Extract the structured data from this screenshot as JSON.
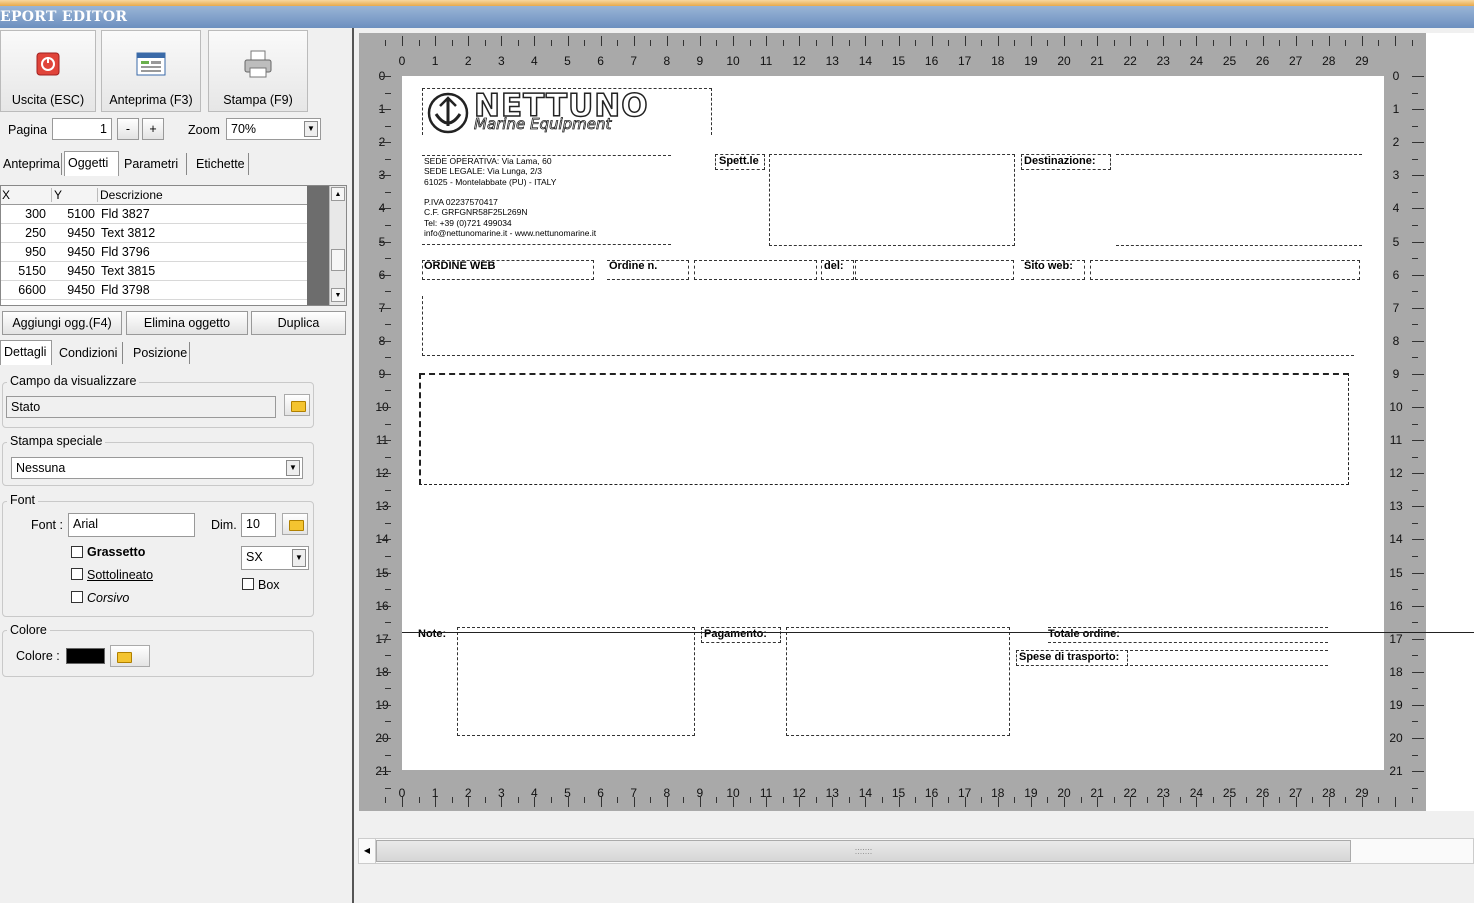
{
  "window": {
    "title": "EPORT EDITOR"
  },
  "toolbar": {
    "exit_label": "Uscita (ESC)",
    "preview_label": "Anteprima (F3)",
    "print_label": "Stampa (F9)"
  },
  "paging": {
    "page_label": "Pagina",
    "page_value": "1",
    "minus": "-",
    "plus": "+",
    "zoom_label": "Zoom",
    "zoom_value": "70%"
  },
  "tabs_top": [
    {
      "label": "Anteprima"
    },
    {
      "label": "Oggetti"
    },
    {
      "label": "Parametri"
    },
    {
      "label": "Etichette"
    }
  ],
  "objects_table": {
    "headers": {
      "x": "X",
      "y": "Y",
      "desc": "Descrizione"
    },
    "rows": [
      {
        "x": "300",
        "y": "5100",
        "desc": "Fld 3827"
      },
      {
        "x": "250",
        "y": "9450",
        "desc": "Text 3812"
      },
      {
        "x": "950",
        "y": "9450",
        "desc": "Fld 3796"
      },
      {
        "x": "5150",
        "y": "9450",
        "desc": "Text 3815"
      },
      {
        "x": "6600",
        "y": "9450",
        "desc": "Fld 3798"
      }
    ]
  },
  "object_actions": {
    "add": "Aggiungi ogg.(F4)",
    "delete": "Elimina oggetto",
    "duplicate": "Duplica"
  },
  "tabs_detail": [
    {
      "label": "Dettagli"
    },
    {
      "label": "Condizioni"
    },
    {
      "label": "Posizione"
    }
  ],
  "field_group": {
    "title": "Campo da visualizzare",
    "value": "Stato"
  },
  "special_print": {
    "title": "Stampa speciale",
    "value": "Nessuna"
  },
  "font_group": {
    "title": "Font",
    "font_label": "Font :",
    "font_value": "Arial",
    "dim_label": "Dim.",
    "dim_value": "10",
    "bold": "Grassetto",
    "underline": "Sottolineato",
    "italic": "Corsivo",
    "align_value": "SX",
    "box": "Box"
  },
  "color_group": {
    "title": "Colore",
    "label": "Colore :",
    "value": "#000000"
  },
  "report": {
    "logo_main": "NETTUNO",
    "logo_sub": "Marine Equipment",
    "address_lines": [
      "SEDE OPERATIVA: Via Lama, 60",
      "SEDE LEGALE: Via Lunga, 2/3",
      "61025 - Montelabbate (PU) - ITALY",
      "",
      "P.IVA 02237570417",
      "C.F. GRFGNR58F25L269N",
      "Tel: +39 (0)721 499034",
      "info@nettunomarine.it - www.nettunomarine.it"
    ],
    "spett": "Spett.le",
    "destinazione": "Destinazione:",
    "ordine_web": "ORDINE WEB",
    "ordine_n": "Ordine n.",
    "del": "del:",
    "sito_web": "Sito web:",
    "note": "Note:",
    "pagamento": "Pagamento:",
    "totale": "Totale ordine:",
    "spese": "Spese di trasporto:"
  },
  "ruler": {
    "h_numbers": [
      "0",
      "1",
      "2",
      "3",
      "4",
      "5",
      "6",
      "7",
      "8",
      "9",
      "10",
      "11",
      "12",
      "13",
      "14",
      "15",
      "16",
      "17",
      "18",
      "19",
      "20",
      "21",
      "22",
      "23",
      "24",
      "25",
      "26",
      "27",
      "28",
      "29"
    ],
    "v_numbers": [
      "0",
      "1",
      "2",
      "3",
      "4",
      "5",
      "6",
      "7",
      "8",
      "9",
      "10",
      "11",
      "12",
      "13",
      "14",
      "15",
      "16",
      "17",
      "18",
      "19",
      "20",
      "21"
    ]
  },
  "scrollbar": {
    "grip": ":::::::"
  }
}
